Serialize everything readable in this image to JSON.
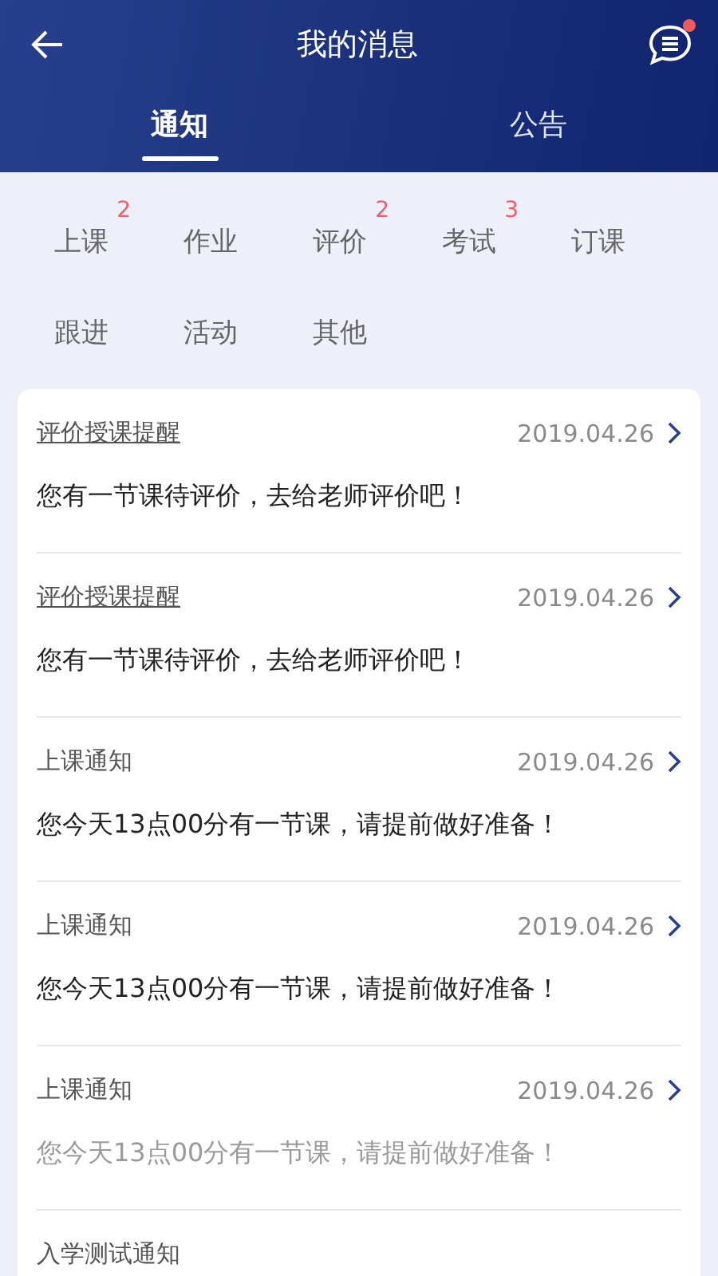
{
  "header": {
    "title": "我的消息",
    "has_unread": true
  },
  "tabs": [
    {
      "label": "通知",
      "selected": true
    },
    {
      "label": "公告",
      "selected": false
    }
  ],
  "categories": [
    {
      "label": "上课",
      "badge": "2"
    },
    {
      "label": "作业"
    },
    {
      "label": "评价",
      "badge": "2"
    },
    {
      "label": "考试",
      "badge": "3"
    },
    {
      "label": "订课"
    },
    {
      "label": "跟进"
    },
    {
      "label": "活动"
    },
    {
      "label": "其他"
    }
  ],
  "messages": [
    {
      "title": "评价授课提醒",
      "underlined": true,
      "date": "2019.04.26",
      "body": "您有一节课待评价，去给老师评价吧！",
      "read": false
    },
    {
      "title": "评价授课提醒",
      "underlined": true,
      "date": "2019.04.26",
      "body": "您有一节课待评价，去给老师评价吧！",
      "read": false
    },
    {
      "title": "上课通知",
      "underlined": false,
      "date": "2019.04.26",
      "body": "您今天13点00分有一节课，请提前做好准备！",
      "read": false
    },
    {
      "title": "上课通知",
      "underlined": false,
      "date": "2019.04.26",
      "body": "您今天13点00分有一节课，请提前做好准备！",
      "read": false
    },
    {
      "title": "上课通知",
      "underlined": false,
      "date": "2019.04.26",
      "body": "您今天13点00分有一节课，请提前做好准备！",
      "read": true
    },
    {
      "title": "入学测试通知",
      "underlined": false
    }
  ]
}
